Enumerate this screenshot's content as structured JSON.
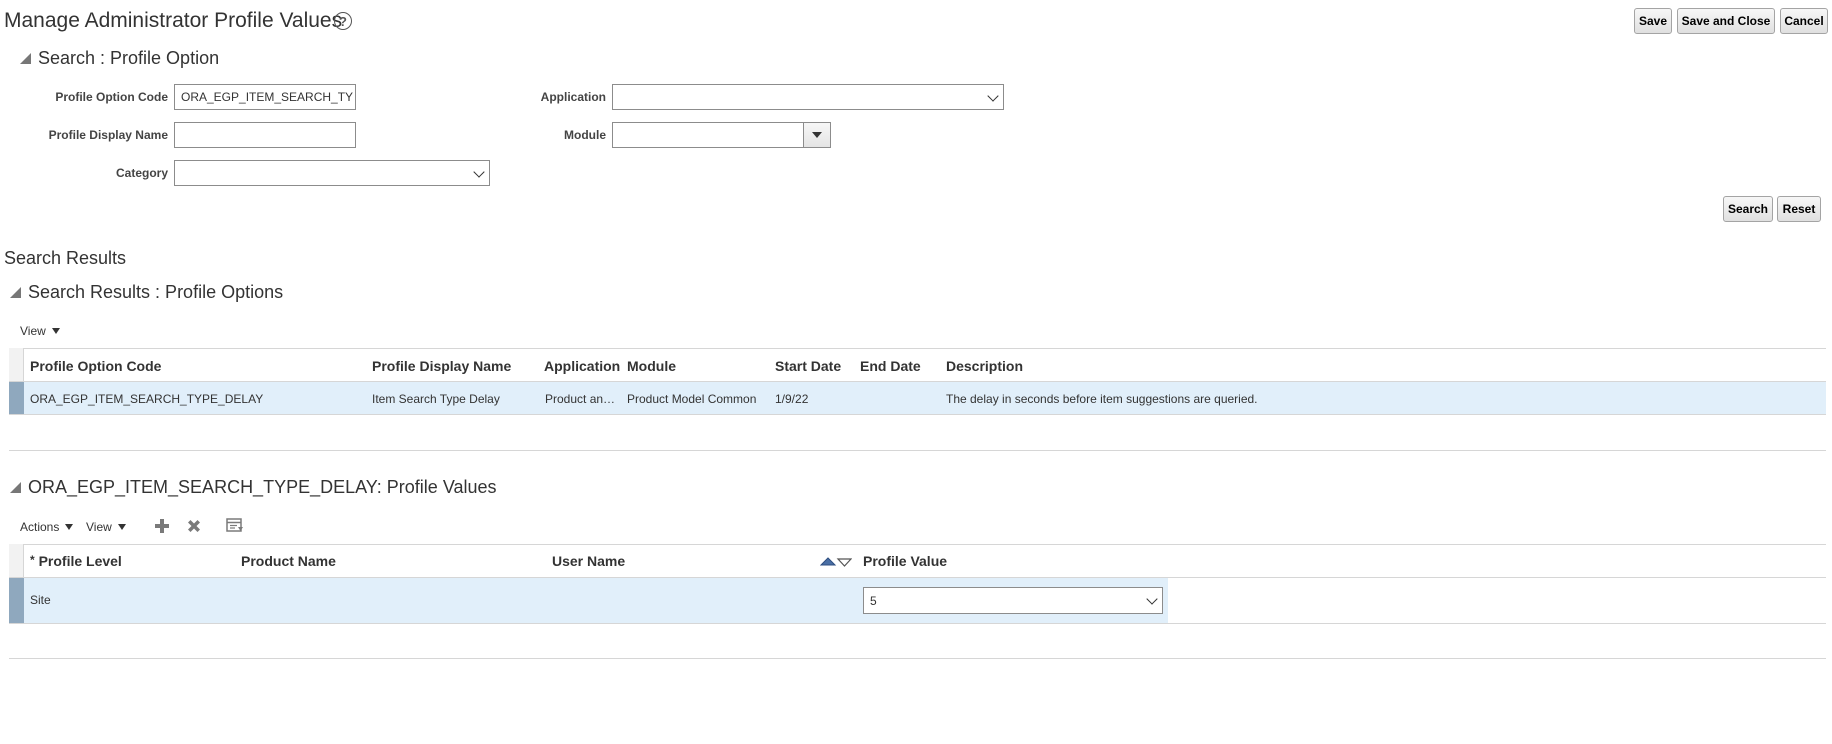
{
  "page": {
    "title": "Manage Administrator Profile Values",
    "help_icon": "help-circle-icon",
    "buttons": {
      "save": "Save",
      "save_close": "Save and Close",
      "cancel": "Cancel"
    }
  },
  "search": {
    "title": "Search : Profile Option",
    "fields": {
      "profile_option_code": {
        "label": "Profile Option Code",
        "value": "ORA_EGP_ITEM_SEARCH_TY"
      },
      "profile_display_name": {
        "label": "Profile Display Name",
        "value": ""
      },
      "category": {
        "label": "Category",
        "value": ""
      },
      "application": {
        "label": "Application",
        "value": ""
      },
      "module": {
        "label": "Module",
        "value": ""
      }
    },
    "buttons": {
      "search": "Search",
      "reset": "Reset"
    }
  },
  "results": {
    "heading": "Search Results",
    "title": "Search Results : Profile Options",
    "view_menu": "View",
    "columns": [
      "Profile Option Code",
      "Profile Display Name",
      "Application",
      "Module",
      "Start Date",
      "End Date",
      "Description"
    ],
    "rows": [
      {
        "code": "ORA_EGP_ITEM_SEARCH_TYPE_DELAY",
        "display_name": "Item Search Type Delay",
        "application": "Product an…",
        "module": "Product Model Common",
        "start_date": "1/9/22",
        "end_date": "",
        "description": "The delay in seconds before item suggestions are queried."
      }
    ]
  },
  "values": {
    "title": "ORA_EGP_ITEM_SEARCH_TYPE_DELAY: Profile Values",
    "actions_menu": "Actions",
    "view_menu": "View",
    "toolbar_icons": [
      "add-icon",
      "delete-icon",
      "freeze-columns-icon"
    ],
    "required_marker": "*",
    "columns": [
      "Profile Level",
      "Product Name",
      "User Name",
      "Profile Value"
    ],
    "rows": [
      {
        "profile_level": "Site",
        "product_name": "",
        "user_name": "",
        "profile_value": "5"
      }
    ]
  },
  "colors": {
    "selected_row": "#e1effa",
    "row_marker": "#8fa8be",
    "border": "#d6d6d6"
  }
}
